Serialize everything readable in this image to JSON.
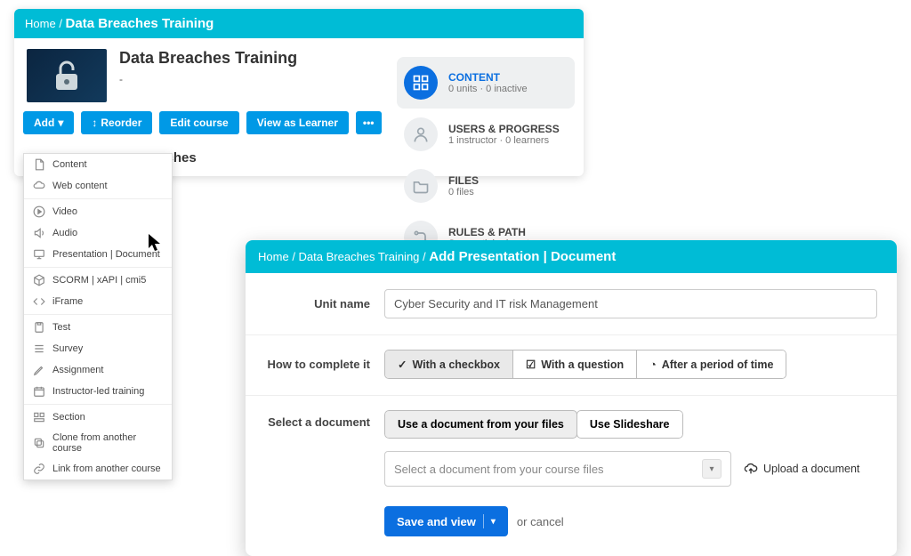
{
  "panel1": {
    "breadcrumb": {
      "home": "Home",
      "current": "Data Breaches Training"
    },
    "course": {
      "title": "Data Breaches Training",
      "subtitle": "-"
    },
    "toolbar": {
      "add": "Add",
      "reorder": "Reorder",
      "edit": "Edit course",
      "view_as": "View as Learner"
    },
    "heading": "reaches",
    "add_menu": [
      "Content",
      "Web content",
      "Video",
      "Audio",
      "Presentation | Document",
      "SCORM | xAPI | cmi5",
      "iFrame",
      "Test",
      "Survey",
      "Assignment",
      "Instructor-led training",
      "Section",
      "Clone from another course",
      "Link from another course"
    ],
    "side": {
      "content": {
        "title": "CONTENT",
        "sub": "0 units · 0 inactive"
      },
      "users": {
        "title": "USERS & PROGRESS",
        "sub": "1 instructor · 0 learners"
      },
      "files": {
        "title": "FILES",
        "sub": "0 files"
      },
      "rules": {
        "title": "RULES & PATH",
        "sub": "Sequential rule set"
      }
    }
  },
  "panel2": {
    "breadcrumb": {
      "home": "Home",
      "course": "Data Breaches Training",
      "current": "Add Presentation | Document"
    },
    "form": {
      "unit_name_label": "Unit name",
      "unit_name_value": "Cyber Security and IT risk Management",
      "complete_label": "How to complete it",
      "complete_options": {
        "checkbox": "With a checkbox",
        "question": "With a question",
        "time": "After a period of time"
      },
      "select_doc_label": "Select a document",
      "doc_options": {
        "from_files": "Use a document from your files",
        "slideshare": "Use Slideshare"
      },
      "dropdown_placeholder": "Select a document from your course files",
      "upload": "Upload a document",
      "save": "Save and view",
      "or": "or",
      "cancel": "cancel"
    }
  }
}
